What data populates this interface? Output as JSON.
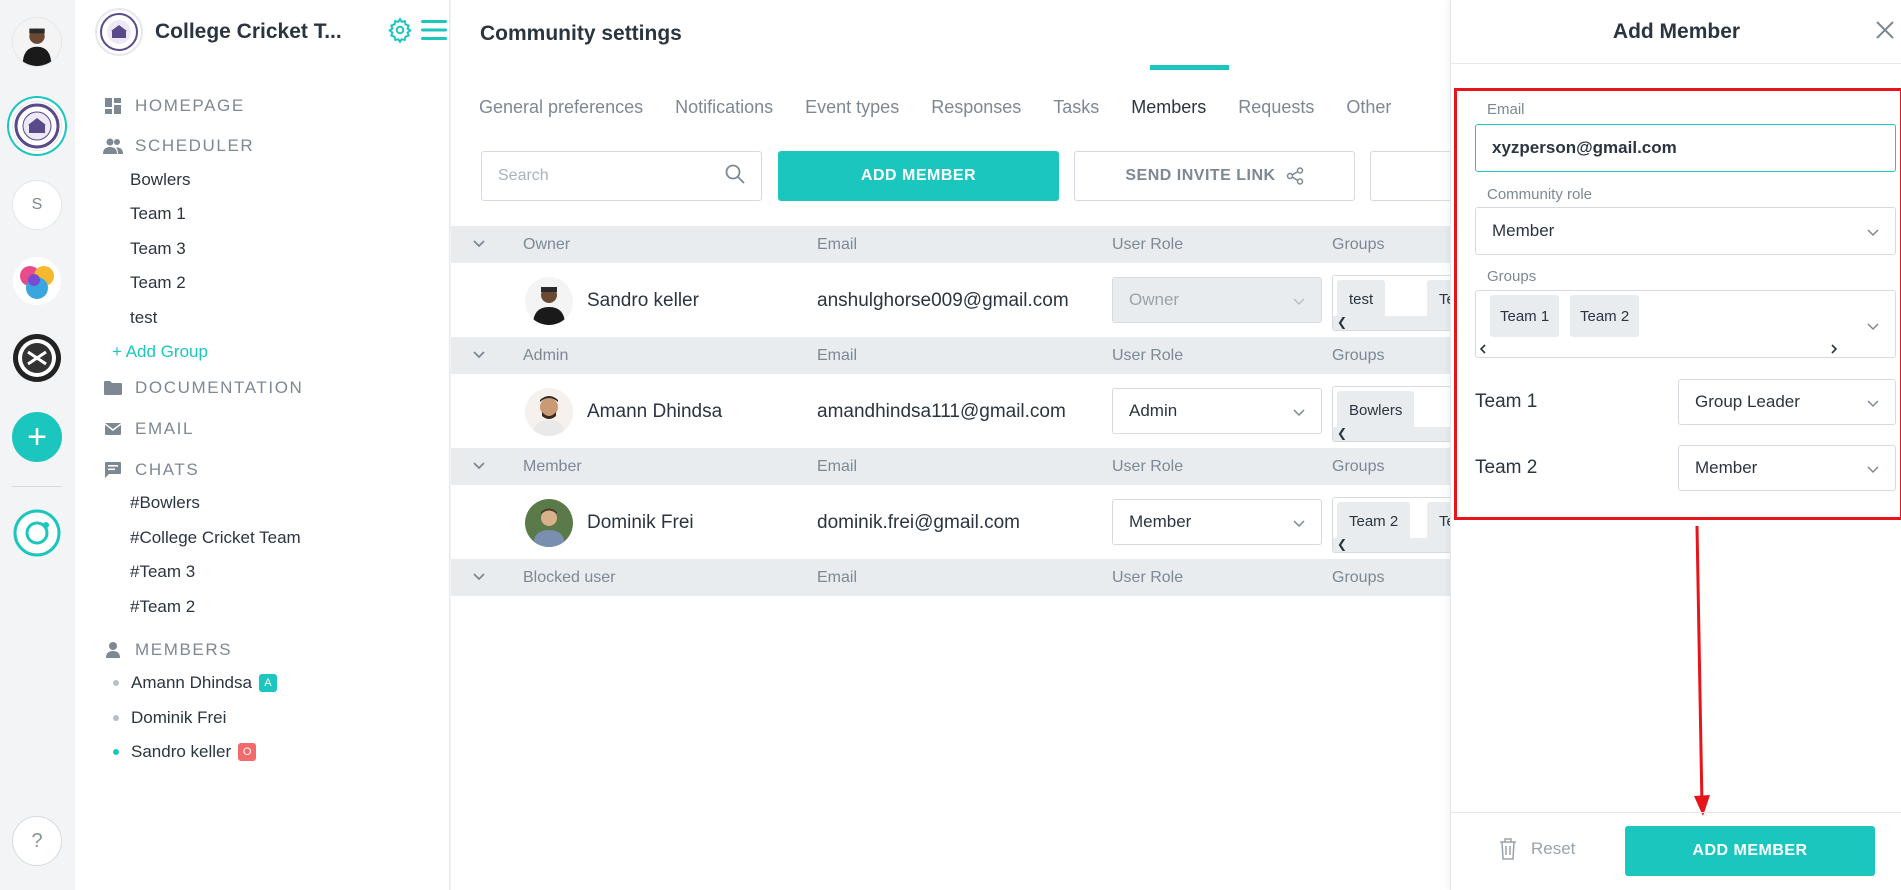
{
  "colors": {
    "accent": "#1bc6bf",
    "highlight": "#e8141c",
    "admin_badge": "#1bc6bf",
    "owner_badge": "#f26a6a"
  },
  "rail": {
    "s_label": "S",
    "help_label": "?"
  },
  "sidebar": {
    "title": "College Cricket T...",
    "homepage": "HOMEPAGE",
    "scheduler": "SCHEDULER",
    "groups": [
      "Bowlers",
      "Team 1",
      "Team 3",
      "Team 2",
      "test"
    ],
    "add_group": "+ Add Group",
    "documentation": "DOCUMENTATION",
    "email": "EMAIL",
    "chats_label": "CHATS",
    "chats": [
      "#Bowlers",
      "#College Cricket Team",
      "#Team 3",
      "#Team 2"
    ],
    "members_label": "MEMBERS",
    "members": [
      {
        "name": "Amann Dhindsa",
        "badge": "A",
        "online": false
      },
      {
        "name": "Dominik Frei",
        "badge": "",
        "online": false
      },
      {
        "name": "Sandro keller",
        "badge": "O",
        "online": true
      }
    ]
  },
  "main": {
    "title": "Community settings",
    "tabs": [
      "General preferences",
      "Notifications",
      "Event types",
      "Responses",
      "Tasks",
      "Members",
      "Requests",
      "Other"
    ],
    "active_tab": "Members",
    "search_placeholder": "Search",
    "add_member": "ADD MEMBER",
    "send_invite": "SEND INVITE LINK",
    "columns": {
      "email": "Email",
      "user_role": "User Role",
      "groups": "Groups"
    },
    "sections": [
      {
        "label": "Owner",
        "rows": [
          {
            "name": "Sandro keller",
            "email": "anshulghorse009@gmail.com",
            "role": "Owner",
            "groups": [
              "test",
              "Te"
            ]
          }
        ]
      },
      {
        "label": "Admin",
        "rows": [
          {
            "name": "Amann Dhindsa",
            "email": "amandhindsa111@gmail.com",
            "role": "Admin",
            "groups": [
              "Bowlers"
            ]
          }
        ]
      },
      {
        "label": "Member",
        "rows": [
          {
            "name": "Dominik Frei",
            "email": "dominik.frei@gmail.com",
            "role": "Member",
            "groups": [
              "Team 2",
              "Te"
            ]
          }
        ]
      },
      {
        "label": "Blocked user",
        "rows": []
      }
    ]
  },
  "panel": {
    "title": "Add Member",
    "email_label": "Email",
    "email_value": "xyzperson@gmail.com",
    "role_label": "Community role",
    "role_value": "Member",
    "groups_label": "Groups",
    "groups": [
      "Team 1",
      "Team 2"
    ],
    "team_roles": [
      {
        "team": "Team 1",
        "role": "Group Leader"
      },
      {
        "team": "Team 2",
        "role": "Member"
      }
    ],
    "reset": "Reset",
    "add_member": "ADD MEMBER"
  }
}
